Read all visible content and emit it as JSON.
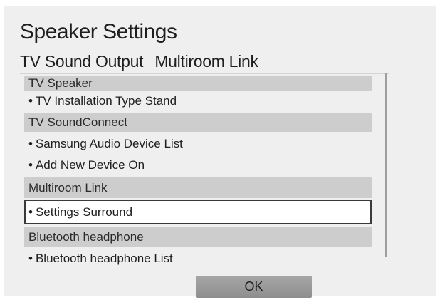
{
  "dialog": {
    "title": "Speaker Settings",
    "tabs": [
      "TV Sound Output",
      "Multiroom Link"
    ]
  },
  "list": {
    "tv_speaker": {
      "header": "TV Speaker",
      "item": "TV Installation Type Stand"
    },
    "soundconnect": {
      "header": "TV SoundConnect",
      "items": [
        "Samsung Audio Device List",
        "Add New Device On"
      ]
    },
    "multiroom": {
      "header": "Multiroom Link",
      "item": "Settings Surround"
    },
    "bluetooth": {
      "header": "Bluetooth headphone",
      "item": "Bluetooth headphone List"
    },
    "bullet": "•"
  },
  "buttons": {
    "ok": "OK"
  },
  "colors": {
    "panel_bg": "#efefef",
    "header_bg": "#cdcdcd",
    "selected_border": "#3a3a3a",
    "button_bg": "#9a9a9a"
  }
}
